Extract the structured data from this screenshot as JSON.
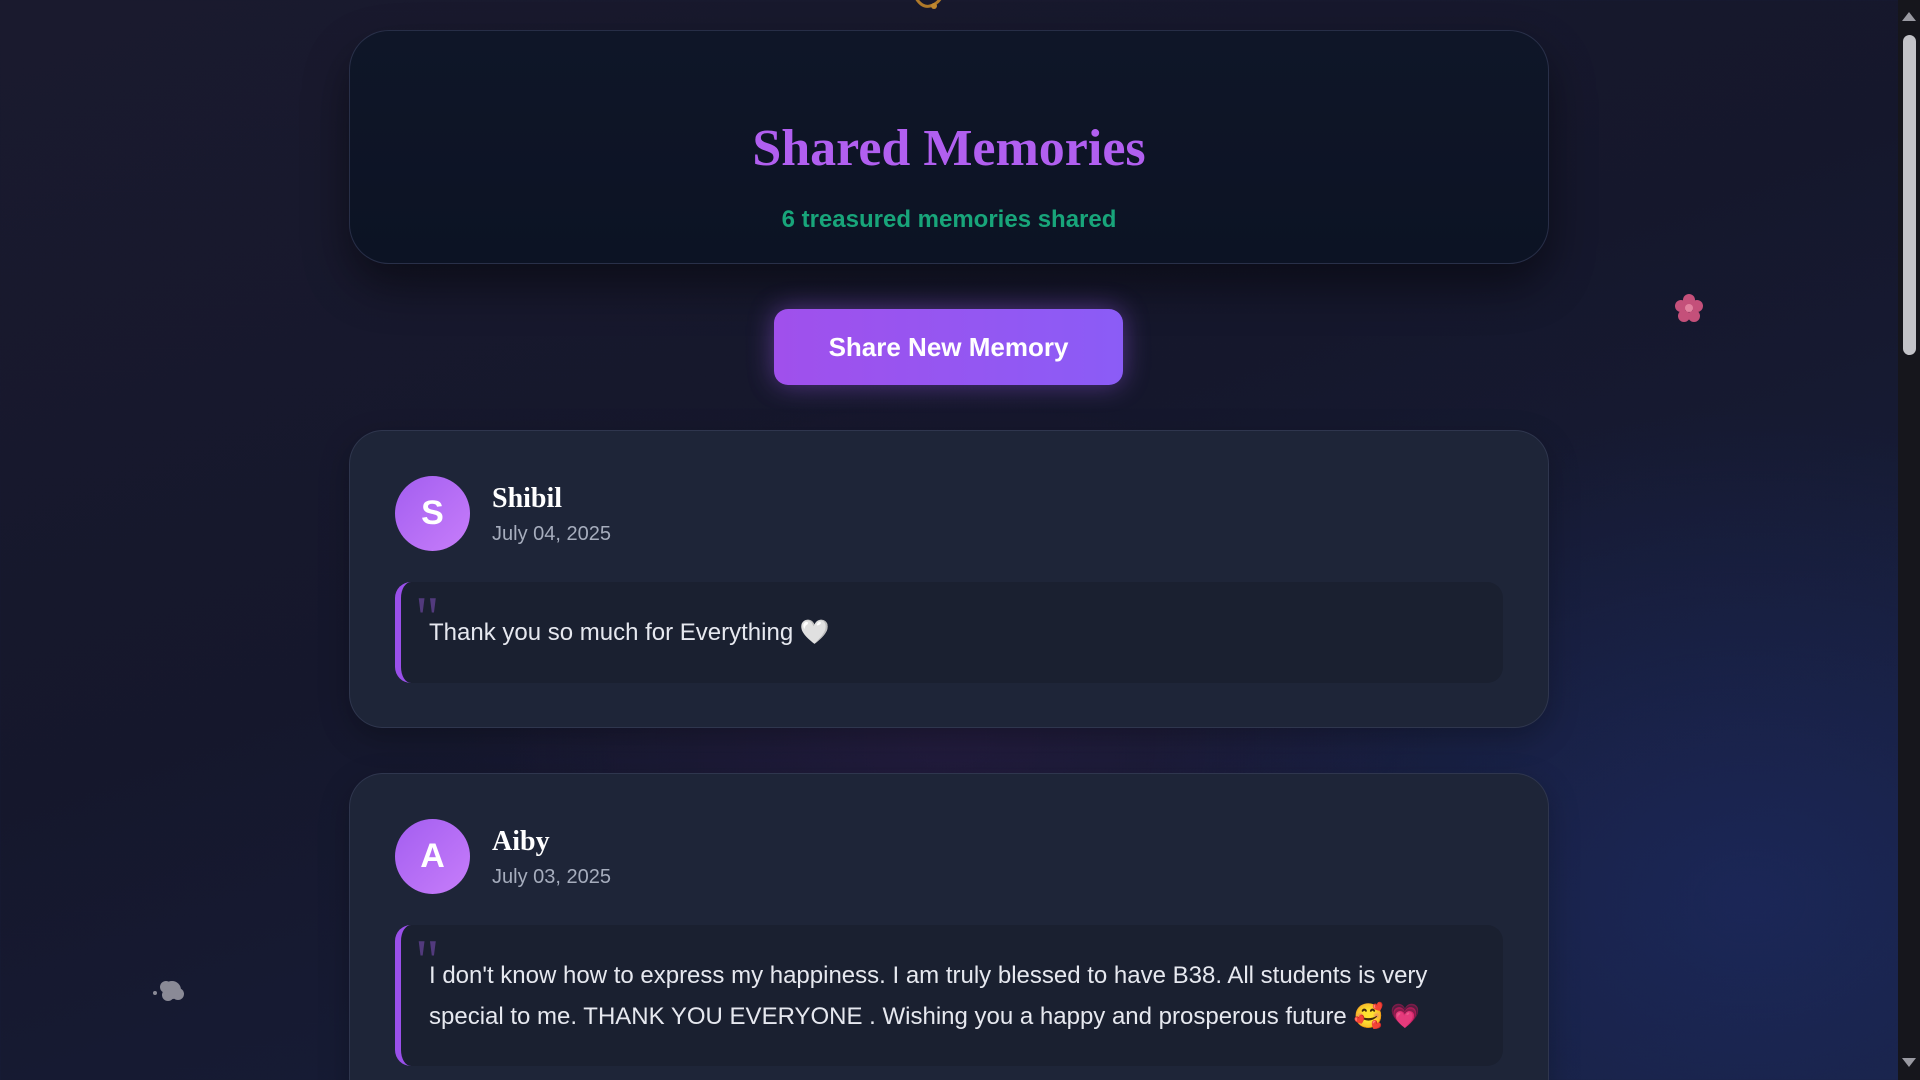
{
  "header": {
    "title": "Shared Memories",
    "subtitle": "6 treasured memories shared"
  },
  "actions": {
    "share_label": "Share New Memory"
  },
  "memories": [
    {
      "initial": "S",
      "author": "Shibil",
      "date": "July 04, 2025",
      "text": "Thank you so much for Everything 🤍"
    },
    {
      "initial": "A",
      "author": "Aiby",
      "date": "July 03, 2025",
      "text": "I don't know how to express my happiness. I am truly blessed to have B38. All students is very special to me. THANK YOU EVERYONE . Wishing you a happy and prosperous future 🥰 💗"
    }
  ],
  "theme": {
    "accent": "#a050ec",
    "title_color": "#b15ff0",
    "subtitle_color": "#18a57a",
    "card_bg": "#1e2538"
  },
  "decorations": [
    "bird-icon",
    "flower-icon",
    "cloud-icon"
  ]
}
